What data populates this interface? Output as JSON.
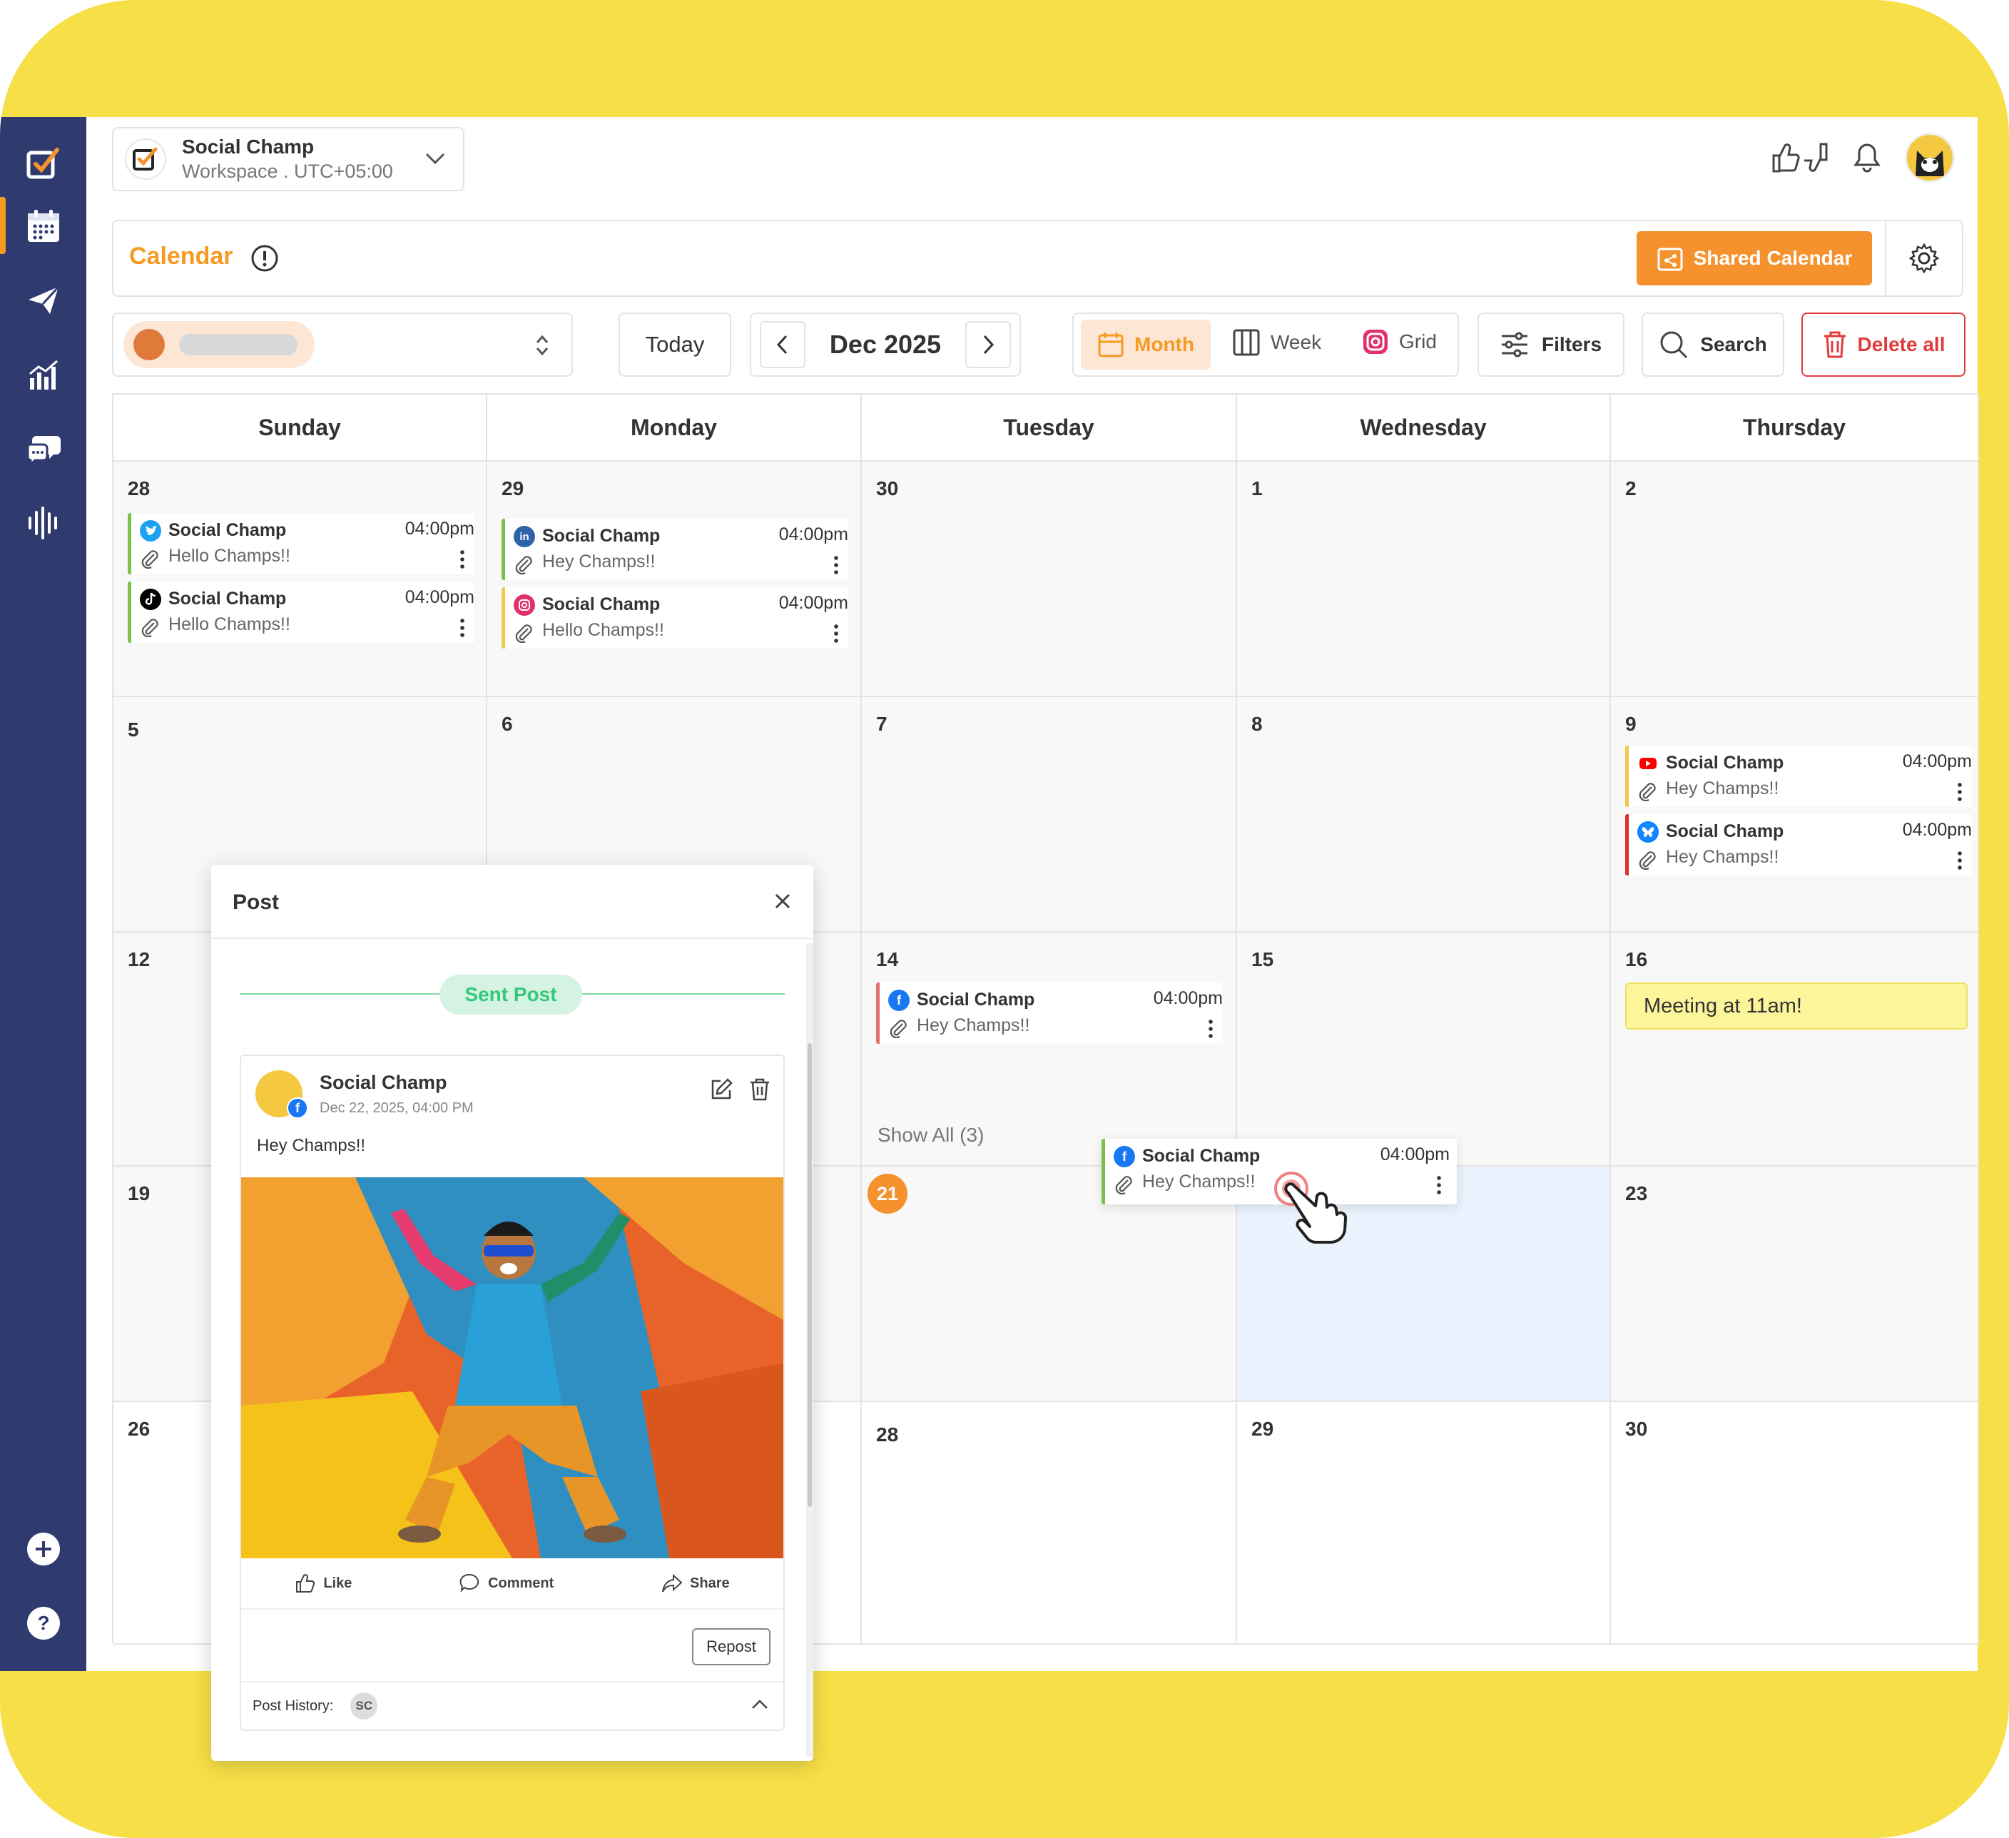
{
  "workspace": {
    "name": "Social Champ",
    "sub": "Workspace . UTC+05:00"
  },
  "header": {
    "title": "Calendar",
    "shared_calendar": "Shared Calendar"
  },
  "toolbar": {
    "today": "Today",
    "month_label": "Dec 2025",
    "views": {
      "month": "Month",
      "week": "Week",
      "grid": "Grid"
    },
    "filters": "Filters",
    "search": "Search",
    "delete_all": "Delete all"
  },
  "days": [
    "Sunday",
    "Monday",
    "Tuesday",
    "Wednesday",
    "Thursday"
  ],
  "dates": {
    "r0": [
      "28",
      "29",
      "30",
      "1",
      "2"
    ],
    "r1": [
      "5",
      "6",
      "7",
      "8",
      "9"
    ],
    "r2": [
      "12",
      "",
      "14",
      "15",
      "16"
    ],
    "r3": [
      "19",
      "",
      "21",
      "",
      "23"
    ],
    "r4": [
      "26",
      "",
      "28",
      "29",
      "30"
    ]
  },
  "posts": {
    "sun28_a": {
      "name": "Social Champ",
      "time": "04:00pm",
      "text": "Hello Champs!!",
      "network": "twitter-icon"
    },
    "sun28_b": {
      "name": "Social Champ",
      "time": "04:00pm",
      "text": "Hello Champs!!",
      "network": "tiktok-icon"
    },
    "mon29_a": {
      "name": "Social Champ",
      "time": "04:00pm",
      "text": "Hey Champs!!",
      "network": "linkedin-icon"
    },
    "mon29_b": {
      "name": "Social Champ",
      "time": "04:00pm",
      "text": "Hello Champs!!",
      "network": "instagram-icon"
    },
    "thu9_a": {
      "name": "Social Champ",
      "time": "04:00pm",
      "text": "Hey Champs!!",
      "network": "youtube-icon"
    },
    "thu9_b": {
      "name": "Social Champ",
      "time": "04:00pm",
      "text": "Hey Champs!!",
      "network": "bluesky-icon"
    },
    "tue14_a": {
      "name": "Social Champ",
      "time": "04:00pm",
      "text": "Hey Champs!!",
      "network": "facebook-icon"
    },
    "drag": {
      "name": "Social Champ",
      "time": "04:00pm",
      "text": "Hey Champs!!",
      "network": "facebook-icon"
    }
  },
  "meeting": "Meeting at 11am!",
  "show_all": "Show All (3)",
  "modal": {
    "title": "Post",
    "status": "Sent Post",
    "name": "Social Champ",
    "date": "Dec 22, 2025, 04:00 PM",
    "text": "Hey Champs!!",
    "like": "Like",
    "comment": "Comment",
    "share": "Share",
    "repost": "Repost",
    "history_label": "Post History:",
    "history_badge": "SC"
  },
  "colors": {
    "accent": "#f5922e",
    "sidebar": "#2f3a6f",
    "danger": "#e23b3b",
    "sent": "#36c77a",
    "frame": "#f7df47"
  }
}
